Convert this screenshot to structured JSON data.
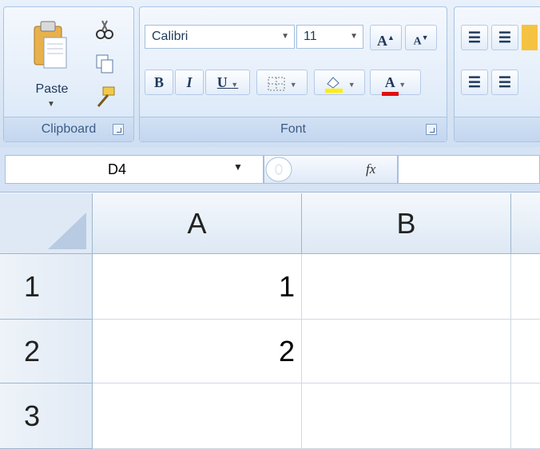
{
  "ribbon": {
    "clipboard": {
      "group_label": "Clipboard",
      "paste_label": "Paste",
      "icons": [
        "paste-icon",
        "cut-icon",
        "copy-icon",
        "format-painter-icon"
      ]
    },
    "font": {
      "group_label": "Font",
      "font_name": "Calibri",
      "font_size": "11",
      "bold": "B",
      "italic": "I",
      "underline": "U",
      "grow": "A",
      "shrink": "A",
      "font_color_letter": "A",
      "fill_color": "#ffee00",
      "font_color": "#e01010"
    }
  },
  "formula_bar": {
    "name_box": "D4",
    "fx_label": "fx",
    "formula": ""
  },
  "grid": {
    "columns": [
      "A",
      "B"
    ],
    "rows": [
      {
        "label": "1",
        "cells": [
          "1",
          ""
        ]
      },
      {
        "label": "2",
        "cells": [
          "2",
          ""
        ]
      },
      {
        "label": "3",
        "cells": [
          "",
          ""
        ]
      }
    ]
  }
}
